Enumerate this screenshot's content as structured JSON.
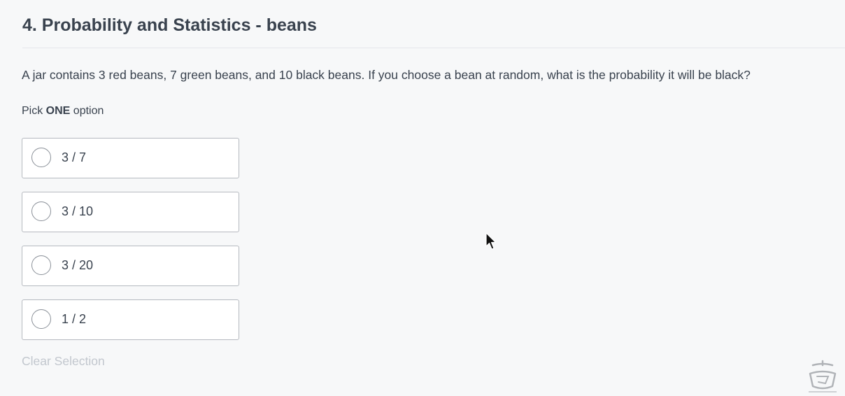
{
  "question": {
    "title": "4. Probability and Statistics - beans",
    "text": "A jar contains 3 red beans, 7 green beans, and 10 black beans. If you choose a bean at random, what is the probability it will be black?",
    "hint_prefix": "Pick ",
    "hint_bold": "ONE",
    "hint_suffix": " option"
  },
  "options": [
    {
      "label": "3 / 7",
      "selected": false
    },
    {
      "label": "3 / 10",
      "selected": false
    },
    {
      "label": "3 / 20",
      "selected": false
    },
    {
      "label": "1 / 2",
      "selected": false
    }
  ],
  "clear_selection_label": "Clear Selection",
  "icons": {
    "radio": "radio-circle-icon",
    "cursor": "mouse-pointer-icon",
    "watermark": "watermark-logo-icon"
  },
  "colors": {
    "background": "#f7f8f9",
    "text": "#39424e",
    "option_border": "#b5b9bf",
    "disabled_text": "#c2c7ce"
  }
}
